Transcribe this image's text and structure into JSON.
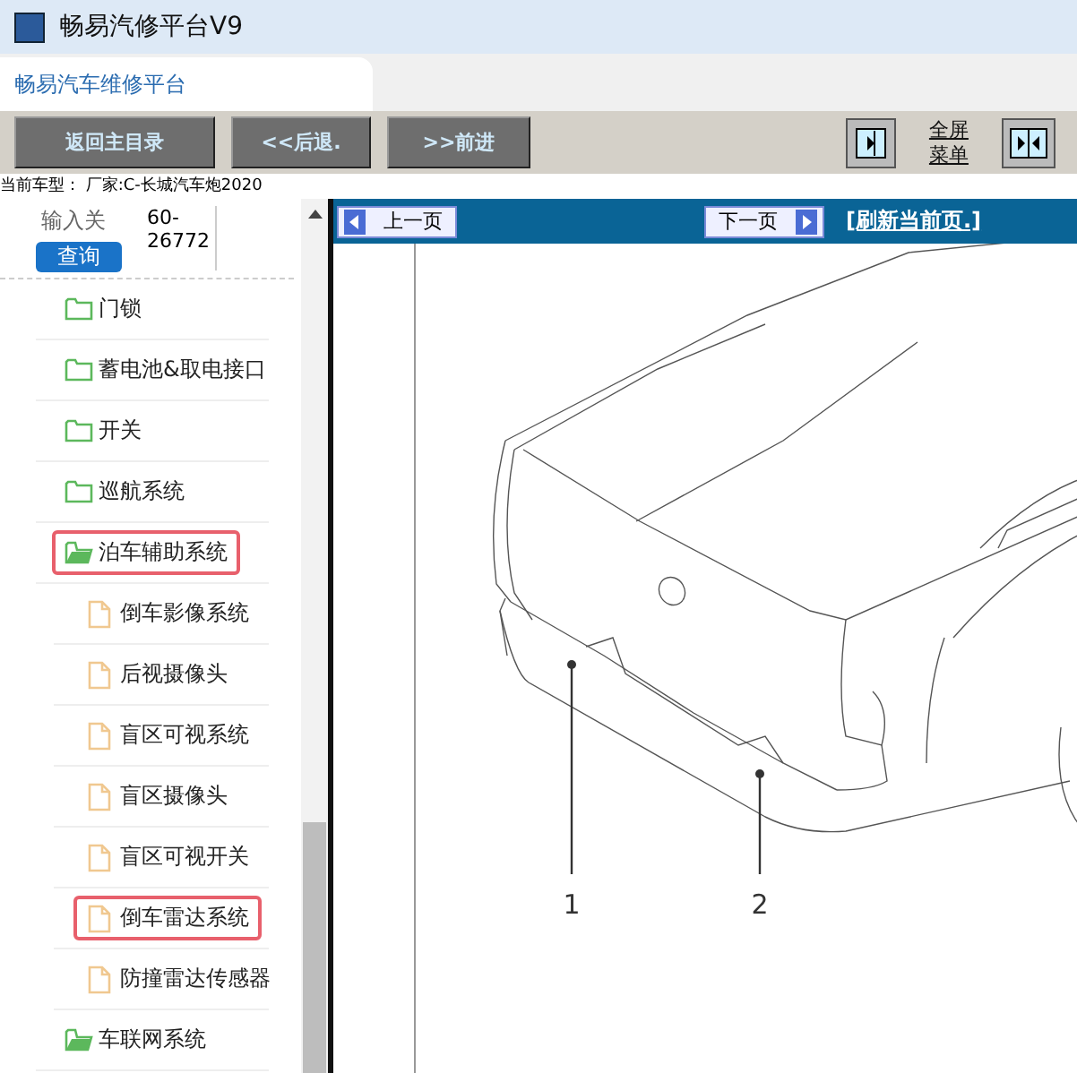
{
  "window": {
    "title": "畅易汽修平台V9"
  },
  "tabs": [
    {
      "label": "畅易汽车维修平台",
      "selected": true
    }
  ],
  "toolbar": {
    "buttons": [
      "返回主目录",
      "<<后退.",
      ">>前进"
    ],
    "fullscreen_link": "全屏菜单"
  },
  "vehicle_line": "当前车型： 厂家:C-长城汽车炮2020",
  "search": {
    "label": "输入关",
    "value": "60-26772",
    "button": "查询"
  },
  "tree": [
    {
      "label": "门锁",
      "kind": "folder",
      "expanded": false,
      "selected": false
    },
    {
      "label": "蓄电池&取电接口",
      "kind": "folder",
      "expanded": false,
      "selected": false
    },
    {
      "label": "开关",
      "kind": "folder",
      "expanded": false,
      "selected": false
    },
    {
      "label": "巡航系统",
      "kind": "folder",
      "expanded": false,
      "selected": false
    },
    {
      "label": "泊车辅助系统",
      "kind": "folder",
      "expanded": true,
      "selected": true,
      "children": [
        {
          "label": "倒车影像系统",
          "kind": "file",
          "selected": false
        },
        {
          "label": "后视摄像头",
          "kind": "file",
          "selected": false
        },
        {
          "label": "盲区可视系统",
          "kind": "file",
          "selected": false
        },
        {
          "label": "盲区摄像头",
          "kind": "file",
          "selected": false
        },
        {
          "label": "盲区可视开关",
          "kind": "file",
          "selected": false
        },
        {
          "label": "倒车雷达系统",
          "kind": "file",
          "selected": true
        },
        {
          "label": "防撞雷达传感器",
          "kind": "file",
          "selected": false
        }
      ]
    },
    {
      "label": "车联网系统",
      "kind": "folder",
      "expanded": true,
      "selected": false
    }
  ],
  "viewer": {
    "prev_button": "上一页",
    "next_button": "下一页",
    "refresh_link": "[刷新当前页.]",
    "callouts": [
      "1",
      "2"
    ]
  }
}
